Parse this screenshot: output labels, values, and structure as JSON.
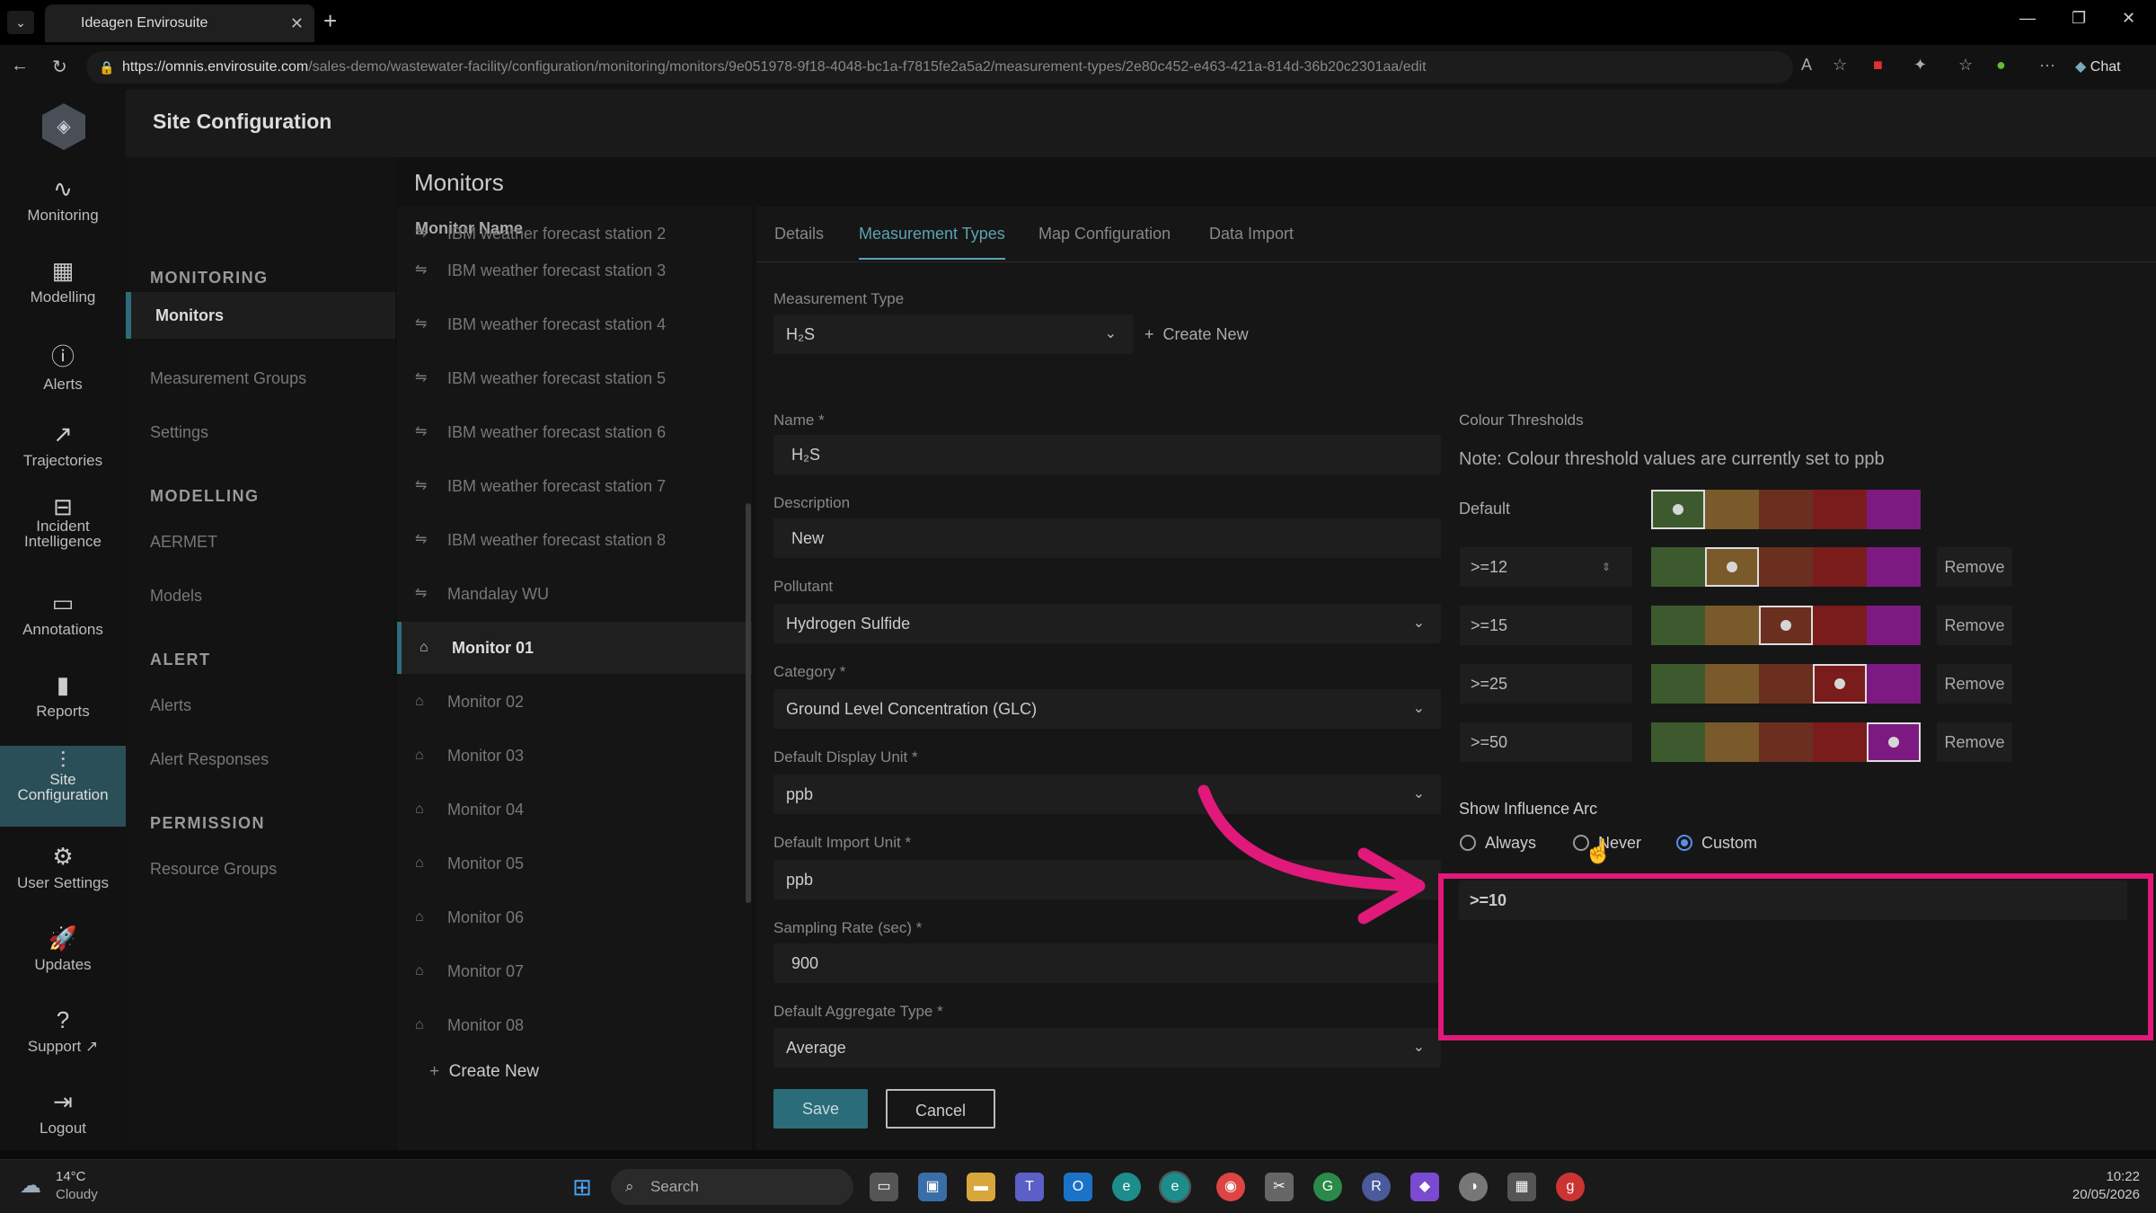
{
  "browser": {
    "tab_title": "Ideagen Envirosuite",
    "url_host": "https://omnis.envirosuite.com",
    "url_path": "/sales-demo/wastewater-facility/configuration/monitoring/monitors/9e051978-9f18-4048-bc1a-f7815fe2a5a2/measurement-types/2e80c452-e463-421a-814d-36b20c2301aa/edit",
    "chat_label": "Chat"
  },
  "app": {
    "page_title": "Site Configuration"
  },
  "rail": [
    {
      "label": "Monitoring",
      "icon": "pulse-icon"
    },
    {
      "label": "Modelling",
      "icon": "layout-icon"
    },
    {
      "label": "Alerts",
      "icon": "alert-circle-icon"
    },
    {
      "label": "Trajectories",
      "icon": "curve-icon"
    },
    {
      "label": "Incident\nIntelligence",
      "icon": "incident-icon"
    },
    {
      "label": "Annotations",
      "icon": "comment-icon"
    },
    {
      "label": "Reports",
      "icon": "bar-chart-icon"
    },
    {
      "label": "Site\nConfiguration",
      "icon": "sliders-icon"
    },
    {
      "label": "User Settings",
      "icon": "gear-icon"
    },
    {
      "label": "Updates",
      "icon": "rocket-icon"
    },
    {
      "label": "Support",
      "icon": "help-icon"
    },
    {
      "label": "Logout",
      "icon": "logout-icon"
    }
  ],
  "secnav": {
    "monitoring_head": "MONITORING",
    "monitors": "Monitors",
    "measurement_groups": "Measurement Groups",
    "settings": "Settings",
    "modelling_head": "MODELLING",
    "aermet": "AERMET",
    "models": "Models",
    "alert_head": "ALERT",
    "alerts": "Alerts",
    "alert_responses": "Alert Responses",
    "permission_head": "PERMISSION",
    "resource_groups": "Resource Groups"
  },
  "monitors": {
    "title": "Monitors",
    "column": "Monitor Name",
    "items": [
      "IBM weather forecast station 2",
      "IBM weather forecast station 3",
      "IBM weather forecast station 4",
      "IBM weather forecast station 5",
      "IBM weather forecast station 6",
      "IBM weather forecast station 7",
      "IBM weather forecast station 8",
      "Mandalay WU",
      "Monitor 01",
      "Monitor 02",
      "Monitor 03",
      "Monitor 04",
      "Monitor 05",
      "Monitor 06",
      "Monitor 07",
      "Monitor 08"
    ],
    "create_new": "Create New"
  },
  "tabs": [
    "Details",
    "Measurement Types",
    "Map Configuration",
    "Data Import"
  ],
  "form": {
    "measurement_type_label": "Measurement Type",
    "measurement_type_value": "H₂S",
    "create_new": "Create New",
    "name_label": "Name *",
    "name_value": "H₂S",
    "description_label": "Description",
    "description_value": "New",
    "pollutant_label": "Pollutant",
    "pollutant_value": "Hydrogen Sulfide",
    "category_label": "Category *",
    "category_value": "Ground Level Concentration (GLC)",
    "display_unit_label": "Default Display Unit *",
    "display_unit_value": "ppb",
    "import_unit_label": "Default Import Unit *",
    "import_unit_value": "ppb",
    "sampling_label": "Sampling Rate (sec) *",
    "sampling_value": "900",
    "aggregate_label": "Default Aggregate Type *",
    "aggregate_value": "Average",
    "save": "Save",
    "cancel": "Cancel"
  },
  "thresholds": {
    "title": "Colour Thresholds",
    "note": "Note: Colour threshold values are currently set to ppb",
    "default_label": "Default",
    "rows": [
      ">=12",
      ">=15",
      ">=25",
      ">=50"
    ],
    "remove": "Remove",
    "colors": [
      "#3c5a2e",
      "#7a5a2a",
      "#6a2f1f",
      "#7a1c1c",
      "#7d1a82"
    ]
  },
  "influence": {
    "title": "Show Influence Arc",
    "options": [
      "Always",
      "Never",
      "Custom"
    ],
    "selected": "Custom",
    "value": ">=10"
  },
  "taskbar": {
    "weather_temp": "14°C",
    "weather_desc": "Cloudy",
    "search": "Search",
    "time": "10:22",
    "date": "20/05/2026"
  }
}
